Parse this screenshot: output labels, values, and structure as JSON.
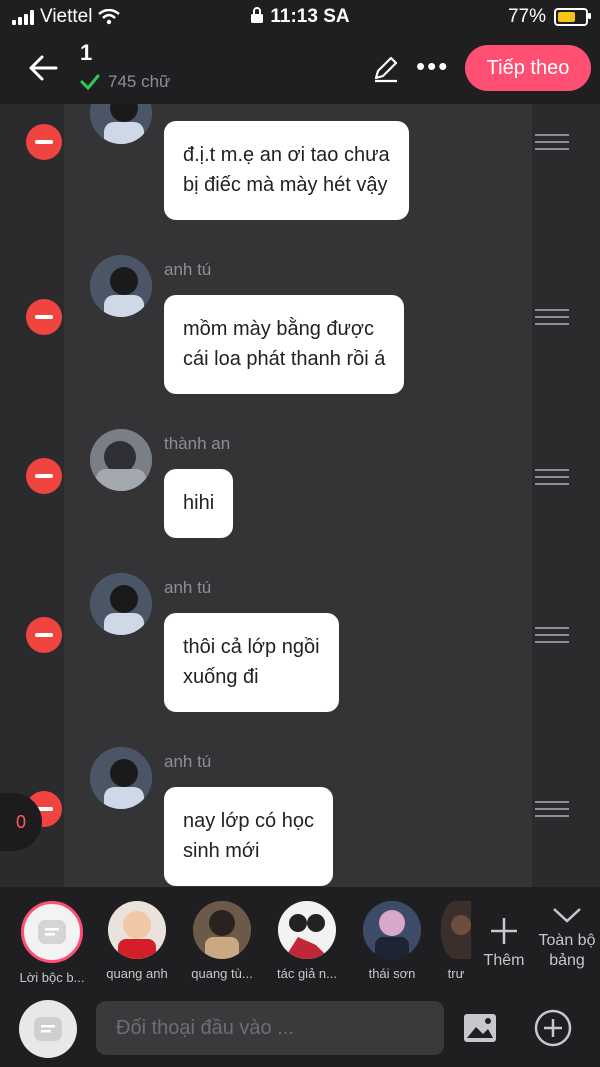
{
  "status": {
    "carrier": "Viettel",
    "time": "11:13 SA",
    "battery": "77%",
    "battery_level": 0.77
  },
  "header": {
    "title": "1",
    "word_count": "745 chữ",
    "next_label": "Tiếp theo"
  },
  "messages": [
    {
      "sender": "",
      "text": "đ.ị.t m.ẹ an ơi tao chưa\nbị điếc mà mày hét vậy"
    },
    {
      "sender": "anh tú",
      "text": "mồm mày bằng được\ncái loa phát thanh rồi á"
    },
    {
      "sender": "thành an",
      "text": "hihi"
    },
    {
      "sender": "anh tú",
      "text": "thôi cả lớp ngồi\nxuống đi"
    },
    {
      "sender": "anh tú",
      "text": "nay lớp có học\nsinh mới"
    }
  ],
  "badge_count": "0",
  "characters": [
    {
      "label": "Lời bộc b..."
    },
    {
      "label": "quang anh"
    },
    {
      "label": "quang tù..."
    },
    {
      "label": "tác giả n..."
    },
    {
      "label": "thái sơn"
    },
    {
      "label": "trư"
    }
  ],
  "more_label": "Thêm",
  "all_label": "Toàn bộ bảng",
  "input": {
    "placeholder": "Đối thoại đầu vào ..."
  },
  "colors": {
    "accent": "#ff4f73",
    "delete": "#f04440"
  }
}
